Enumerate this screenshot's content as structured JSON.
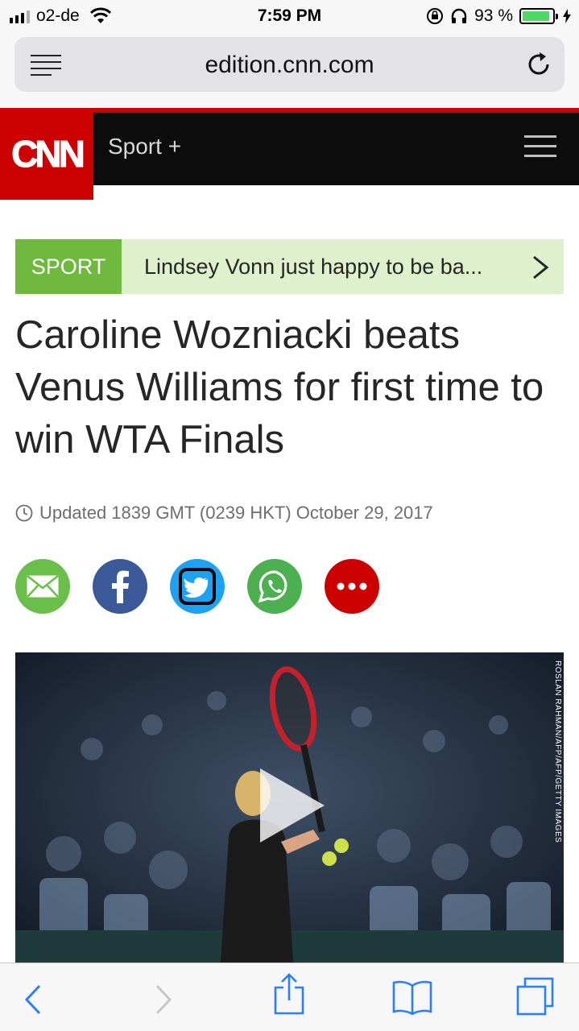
{
  "status_bar": {
    "carrier": "o2-de",
    "time": "7:59 PM",
    "battery_percent": "93 %",
    "battery_level": 0.93
  },
  "browser": {
    "url": "edition.cnn.com"
  },
  "cnn_header": {
    "logo": "CNN",
    "section": "Sport +"
  },
  "strip": {
    "tag": "SPORT",
    "headline": "Lindsey Vonn just happy to be ba..."
  },
  "article": {
    "headline": "Caroline Wozniacki beats Venus Williams for first time to win WTA Finals",
    "updated": "Updated 1839 GMT (0239 HKT) October 29, 2017"
  },
  "share_buttons": [
    {
      "icon": "mail-icon",
      "color": "#6abf4b"
    },
    {
      "icon": "facebook-icon",
      "color": "#3b5998"
    },
    {
      "icon": "twitter-icon",
      "color": "#1da1f2"
    },
    {
      "icon": "whatsapp-icon",
      "color": "#4caf50"
    },
    {
      "icon": "more-icon",
      "color": "#cc0000"
    }
  ],
  "video": {
    "credit": "ROSLAN RAHMAN/AFP/AFP/GETTY IMAGES"
  },
  "colors": {
    "cnn_red": "#cc0000",
    "sport_green": "#70b93f",
    "ios_blue": "#2d7ff9"
  }
}
